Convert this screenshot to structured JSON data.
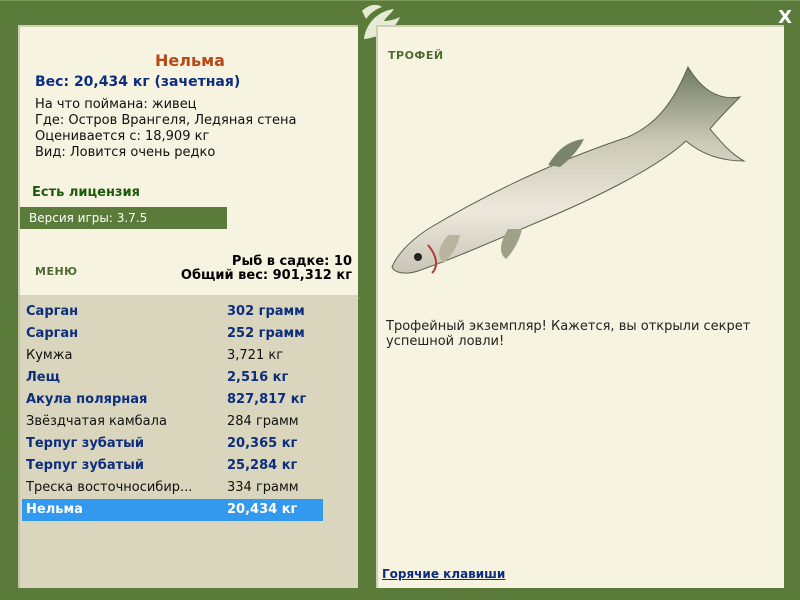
{
  "fish": {
    "name": "Нельма",
    "weight": "Вес: 20,434 кг (зачетная)",
    "caught_on": "На что поймана: живец",
    "where": "Где: Остров Врангеля, Ледяная стена",
    "valued_from": "Оценивается с: 18,909 кг",
    "kind": "Вид: Ловится очень редко"
  },
  "license": "Есть лицензия",
  "version": "Версия игры: 3.7.5",
  "menu_label": "МЕНЮ",
  "cage": {
    "count": "Рыб в садке: 10",
    "total": "Общий вес: 901,312 кг"
  },
  "catch_list": [
    {
      "name": "Сарган",
      "weight": "302 грамм",
      "bold": true
    },
    {
      "name": "Сарган",
      "weight": "252 грамм",
      "bold": true
    },
    {
      "name": "Кумжа",
      "weight": "3,721 кг",
      "bold": false
    },
    {
      "name": "Лещ",
      "weight": "2,516 кг",
      "bold": true
    },
    {
      "name": "Акула полярная",
      "weight": "827,817 кг",
      "bold": true
    },
    {
      "name": "Звёздчатая камбала",
      "weight": "284 грамм",
      "bold": false
    },
    {
      "name": "Терпуг зубатый",
      "weight": "20,365 кг",
      "bold": true
    },
    {
      "name": "Терпуг зубатый",
      "weight": "25,284 кг",
      "bold": true
    },
    {
      "name": "Треска восточносибир...",
      "weight": "334 грамм",
      "bold": false
    },
    {
      "name": "Нельма",
      "weight": "20,434 кг",
      "bold": true,
      "selected": true
    }
  ],
  "trophy_label": "ТРОФЕЙ",
  "trophy_text": "Трофейный экземпляр! Кажется, вы открыли секрет успешной ловли!",
  "hotkeys": "Горячие клавиши",
  "close_label": "X"
}
